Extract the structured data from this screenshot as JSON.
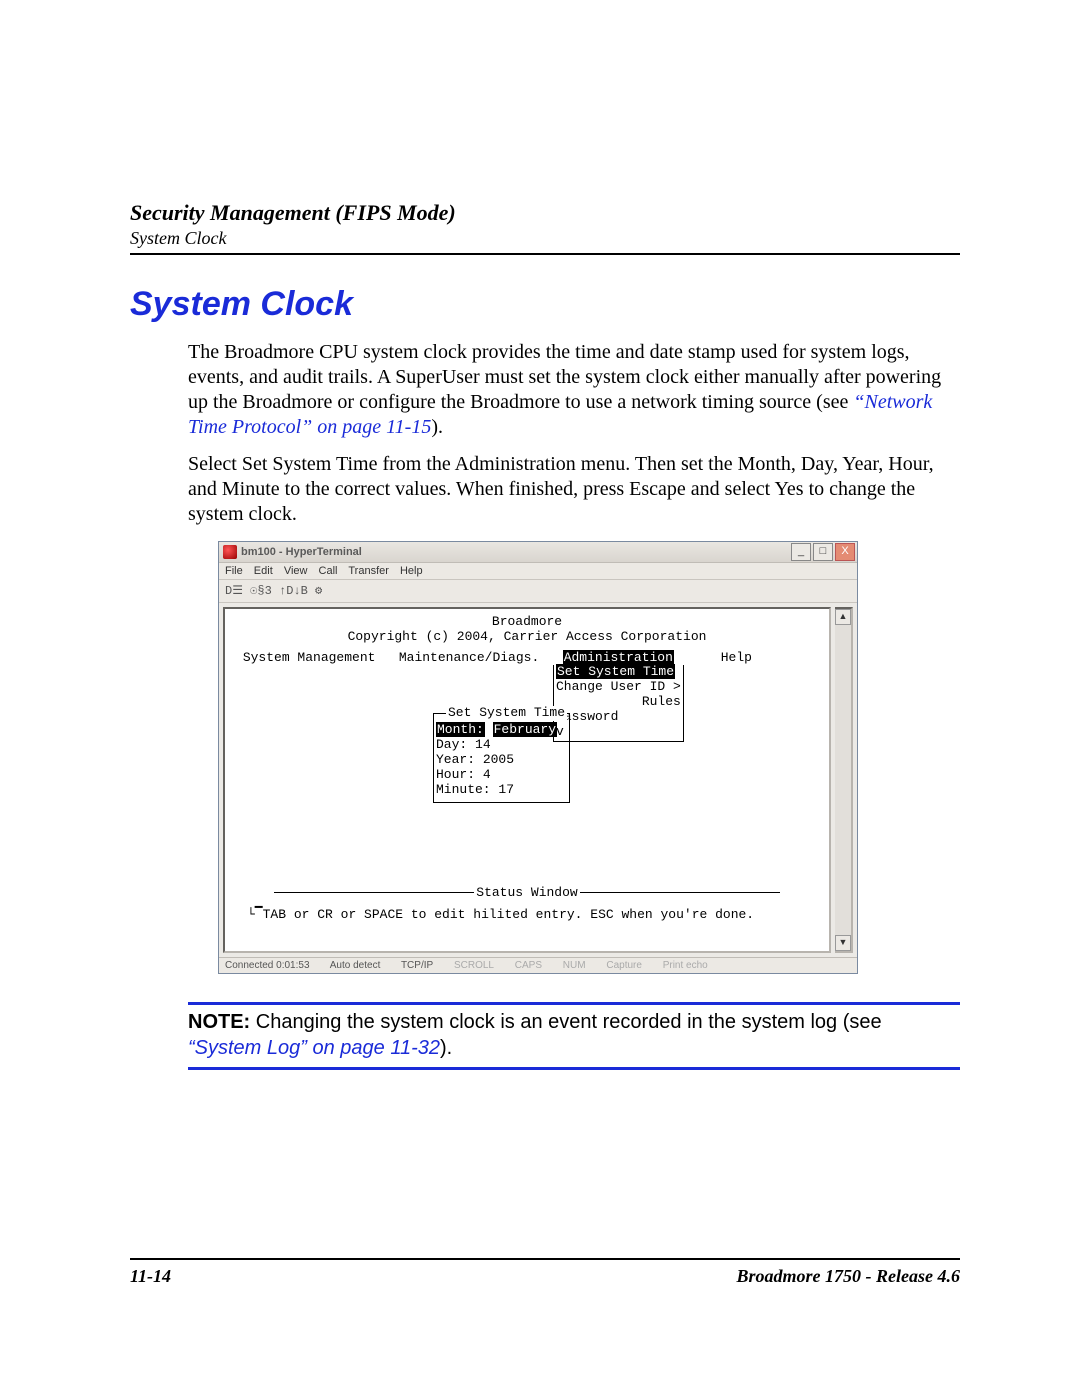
{
  "header": {
    "title": "Security Management (FIPS Mode)",
    "subtitle": "System Clock"
  },
  "section": {
    "heading": "System Clock",
    "para1a": "The Broadmore CPU system clock provides the time and date stamp used for system logs, events, and audit trails.  A SuperUser must set the system clock either manually after powering up the Broadmore or configure the Broadmore to use a network timing source (see ",
    "para1_ref": "“Network Time Protocol” on page 11-15",
    "para1b": ").",
    "para2": "Select Set System Time from the Administration menu. Then set the Month, Day, Year, Hour, and Minute to the correct values. When finished, press Escape and select Yes to change the system clock."
  },
  "screenshot": {
    "window_title": "bm100 - HyperTerminal",
    "menu": {
      "file": "File",
      "edit": "Edit",
      "view": "View",
      "call": "Call",
      "transfer": "Transfer",
      "help": "Help"
    },
    "toolbar": "D☰  ☉§3  ↑D↓B  ⚙",
    "term": {
      "app_name": "Broadmore",
      "copyright": "Copyright (c) 2004, Carrier Access Corporation",
      "menus": {
        "sys_mgmt": "System Management",
        "maint": "Maintenance/Diags.",
        "admin": "Administration",
        "help": "Help"
      },
      "dropdown": {
        "set_time": "Set System Time",
        "change_uid": "Change User ID >",
        "rules": "Rules",
        "password": "Password",
        "v": "v"
      },
      "time_box": {
        "title": "Set System Time",
        "month_lbl": "Month:",
        "month_val": "February",
        "day_lbl": "Day:",
        "day_val": "14",
        "year_lbl": "Year:",
        "year_val": "2005",
        "hour_lbl": "Hour:",
        "hour_val": "4",
        "minute_lbl": "Minute:",
        "minute_val": "17"
      },
      "status_title": "Status Window",
      "status_msg": "└▔TAB or CR or SPACE to edit hilited entry.  ESC when you're done."
    },
    "statusbar": {
      "connected": "Connected 0:01:53",
      "detect": "Auto detect",
      "proto": "TCP/IP",
      "scroll": "SCROLL",
      "caps": "CAPS",
      "num": "NUM",
      "capture": "Capture",
      "echo": "Print echo"
    },
    "ctrls": {
      "min": "_",
      "max": "□",
      "close": "X"
    },
    "scroll_up": "▲",
    "scroll_down": "▼"
  },
  "note": {
    "label": "NOTE:",
    "text1": "  Changing the system clock is an event recorded in the system log (see ",
    "ref": "“System Log” on page 11-32",
    "text2": ")."
  },
  "footer": {
    "page_no": "11-14",
    "doc": "Broadmore 1750 - Release 4.6"
  }
}
